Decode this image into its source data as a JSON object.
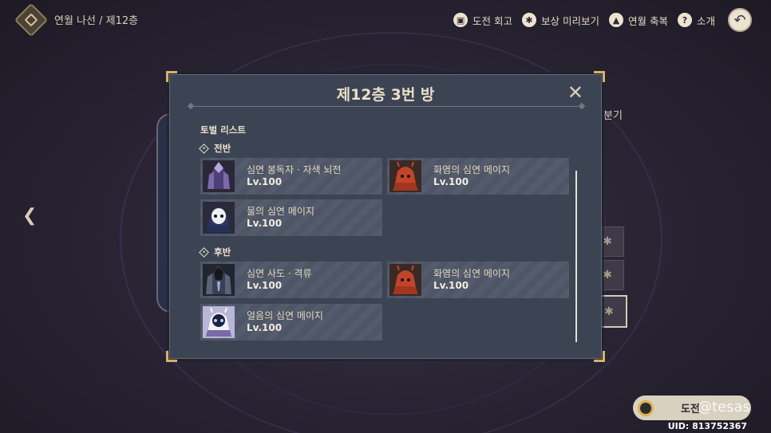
{
  "breadcrumb": "연월 나선 / 제12층",
  "top_actions": [
    {
      "label": "도전 회고",
      "icon": "book-icon"
    },
    {
      "label": "보상 미리보기",
      "icon": "gear-badge-icon"
    },
    {
      "label": "연월 축복",
      "icon": "upload-circle-icon"
    },
    {
      "label": "소개",
      "icon": "question-icon"
    }
  ],
  "back_icon": "back-arrow-icon",
  "behind_text": "분기",
  "modal": {
    "title": "제12층 3번 방",
    "list_header": "토벌 리스트",
    "sections": [
      {
        "label": "전반",
        "enemies": [
          {
            "name": "심연 봉독자 · 자색 뇌전",
            "level": "Lv.100",
            "portrait": "purple-lector"
          },
          {
            "name": "화염의 심연 메이지",
            "level": "Lv.100",
            "portrait": "pyro-mage"
          },
          {
            "name": "물의 심연 메이지",
            "level": "Lv.100",
            "portrait": "hydro-mage"
          }
        ]
      },
      {
        "label": "후반",
        "enemies": [
          {
            "name": "심연 사도 · 격류",
            "level": "Lv.100",
            "portrait": "herald"
          },
          {
            "name": "화염의 심연 메이지",
            "level": "Lv.100",
            "portrait": "pyro-mage"
          },
          {
            "name": "얼음의 심연 메이지",
            "level": "Lv.100",
            "portrait": "cryo-mage"
          }
        ]
      }
    ]
  },
  "challenge_label": "도전",
  "watermark": "@tesas",
  "uid": "UID: 813752367",
  "colors": {
    "accent_gold": "#d9b06a",
    "panel": "#3c4454",
    "text": "#e9dfc6"
  }
}
